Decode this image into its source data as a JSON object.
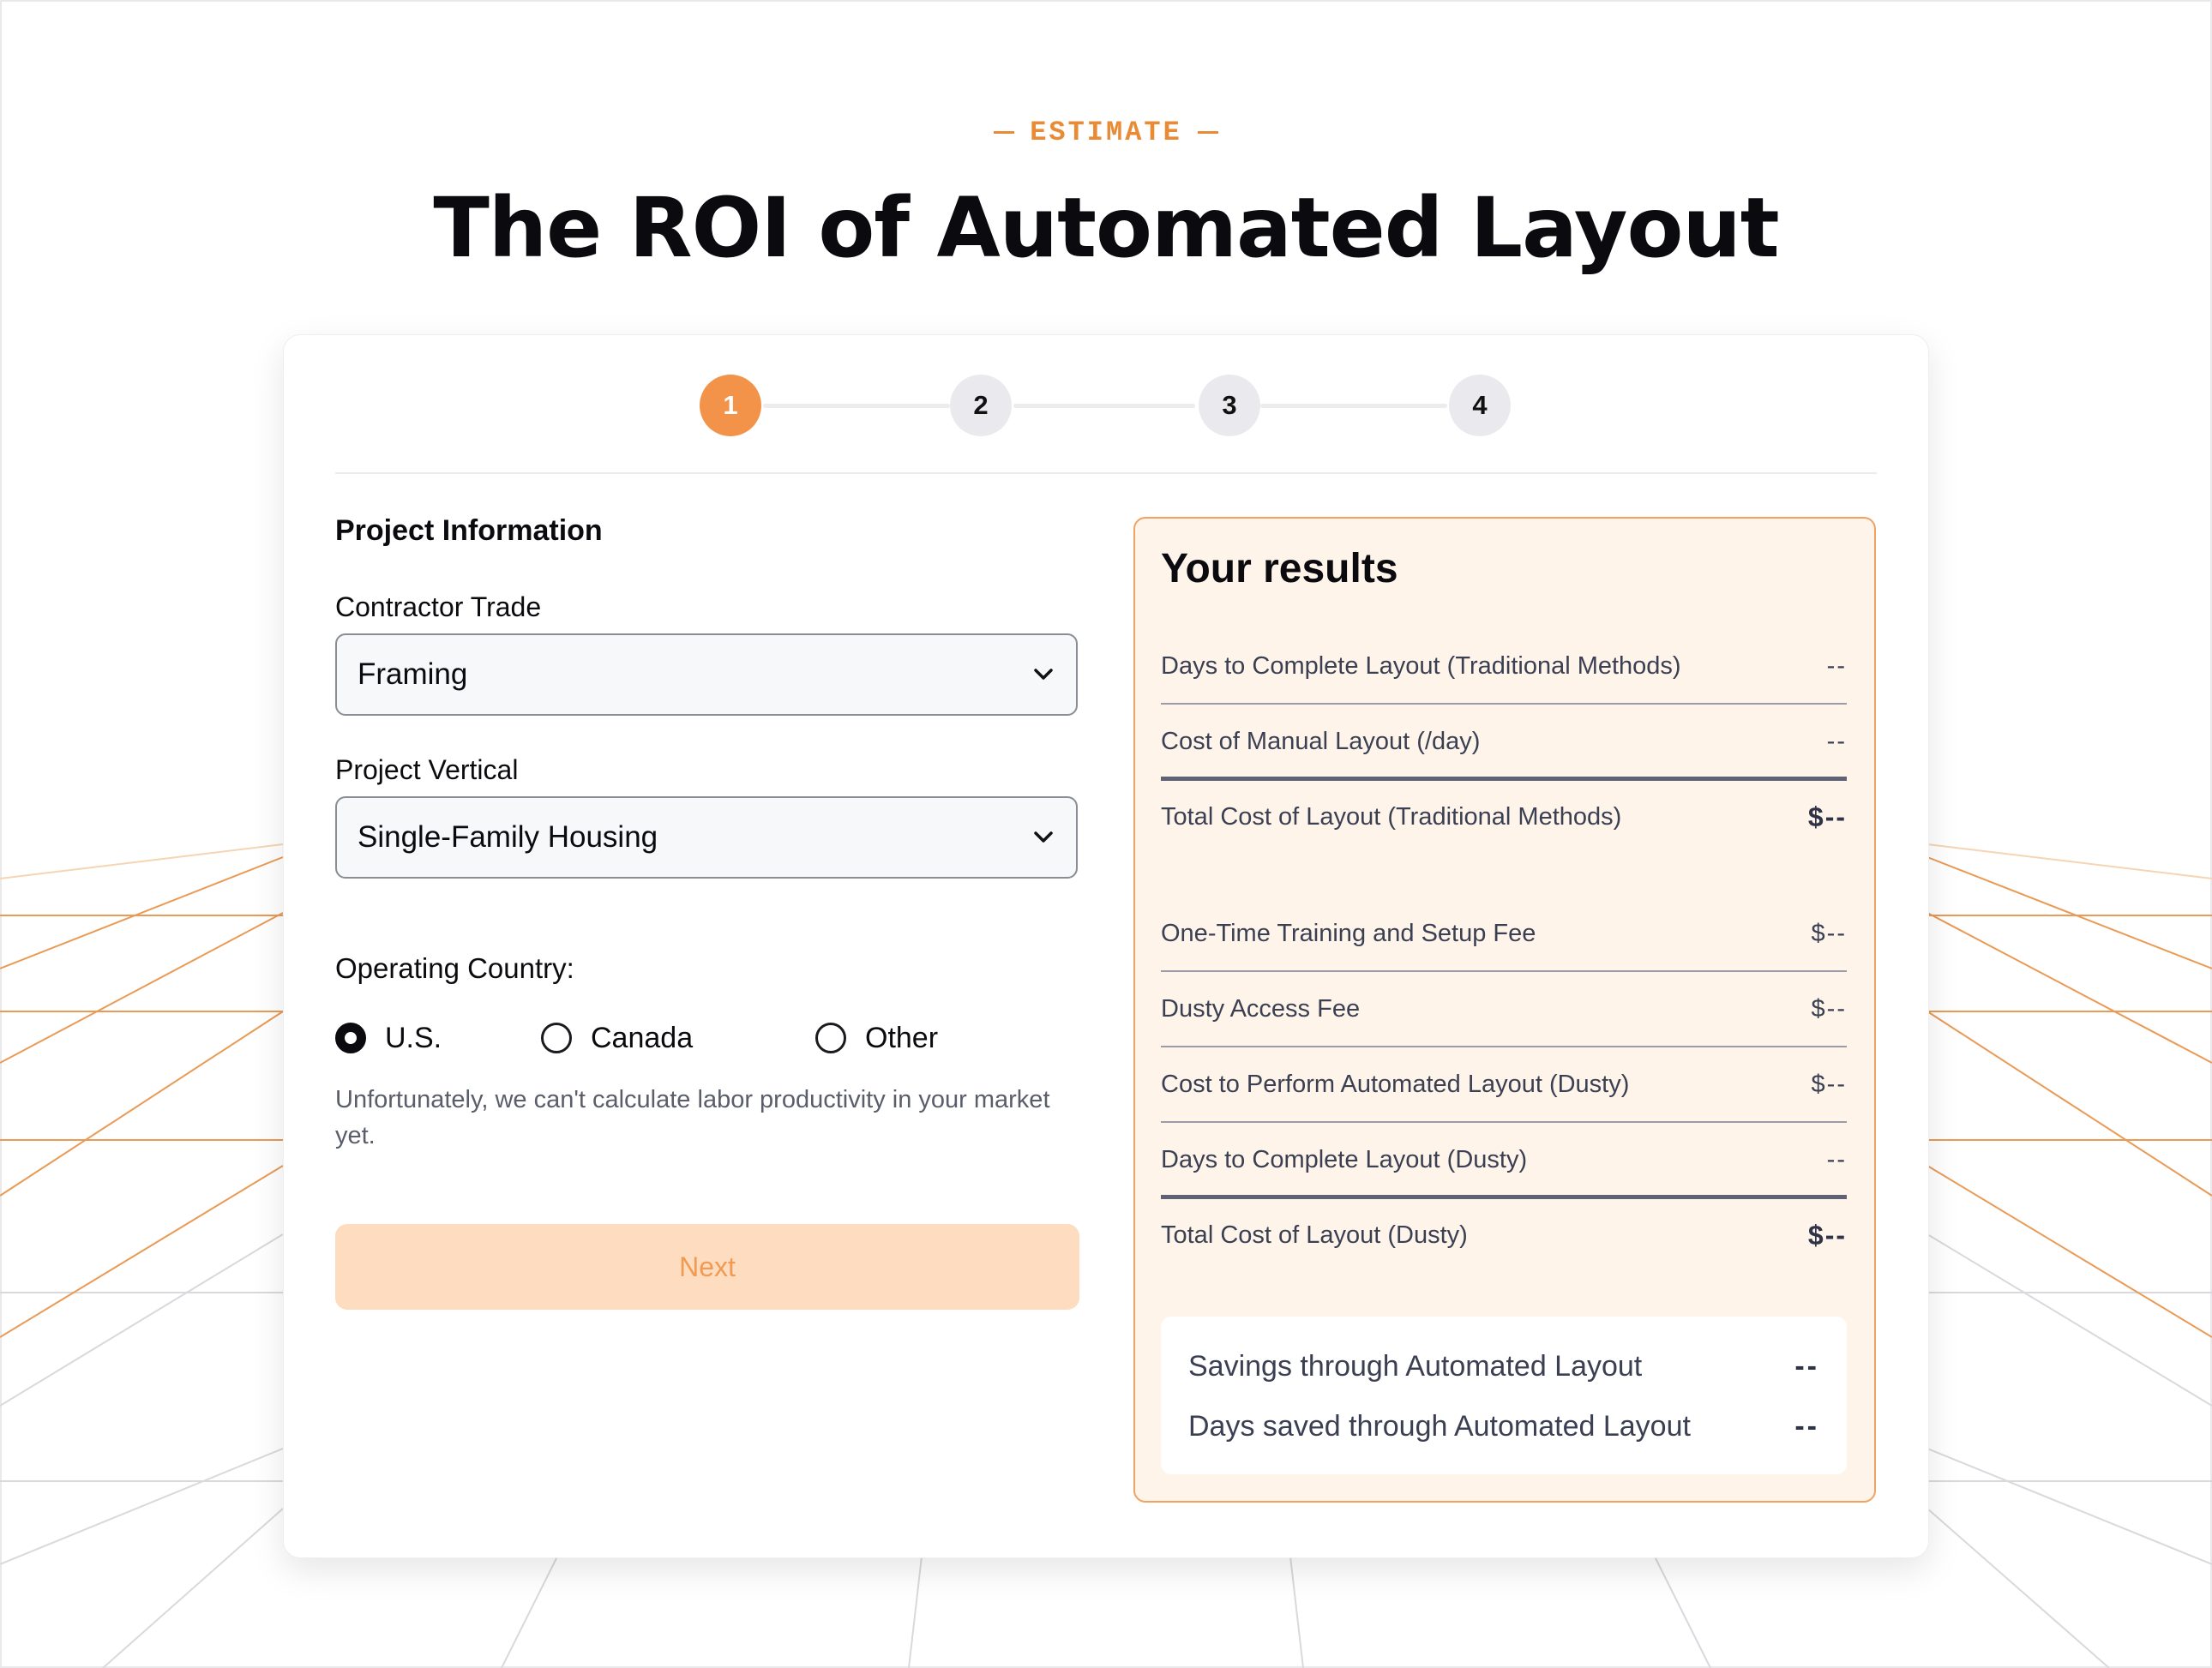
{
  "header": {
    "eyebrow": "ESTIMATE",
    "title": "The ROI of Automated Layout"
  },
  "stepper": {
    "steps": [
      "1",
      "2",
      "3",
      "4"
    ],
    "active_step": 1
  },
  "form": {
    "section_title": "Project Information",
    "contractor_trade": {
      "label": "Contractor Trade",
      "value": "Framing"
    },
    "project_vertical": {
      "label": "Project Vertical",
      "value": "Single-Family Housing"
    },
    "operating_country": {
      "label": "Operating Country:",
      "options": [
        "U.S.",
        "Canada",
        "Other"
      ],
      "selected": "U.S."
    },
    "note": "Unfortunately, we can't calculate labor productivity in your market yet.",
    "next_label": "Next"
  },
  "results": {
    "title": "Your results",
    "rows": [
      {
        "label": "Days to Complete Layout (Traditional Methods)",
        "value": "--"
      },
      {
        "label": "Cost of Manual Layout (/day)",
        "value": "--"
      },
      {
        "label": "Total Cost of Layout (Traditional Methods)",
        "value": "$--"
      },
      {
        "label": "One-Time Training and Setup Fee",
        "value": "$--"
      },
      {
        "label": "Dusty Access Fee",
        "value": "$--"
      },
      {
        "label": "Cost to Perform Automated Layout (Dusty)",
        "value": "$--"
      },
      {
        "label": "Days to Complete Layout (Dusty)",
        "value": "--"
      },
      {
        "label": "Total Cost of Layout (Dusty)",
        "value": "$--"
      }
    ],
    "savings": [
      {
        "label": "Savings through Automated Layout",
        "value": "--"
      },
      {
        "label": "Days saved through Automated Layout",
        "value": "--"
      }
    ]
  },
  "colors": {
    "accent": "#f3934a",
    "results_bg": "#fef4ea",
    "next_bg": "#fddcbf",
    "grid_orange": "#e99a55",
    "grid_gray": "#d7d7db"
  },
  "icons": [
    "chevron-down-icon",
    "radio-checked-icon",
    "radio-unchecked-icon"
  ]
}
